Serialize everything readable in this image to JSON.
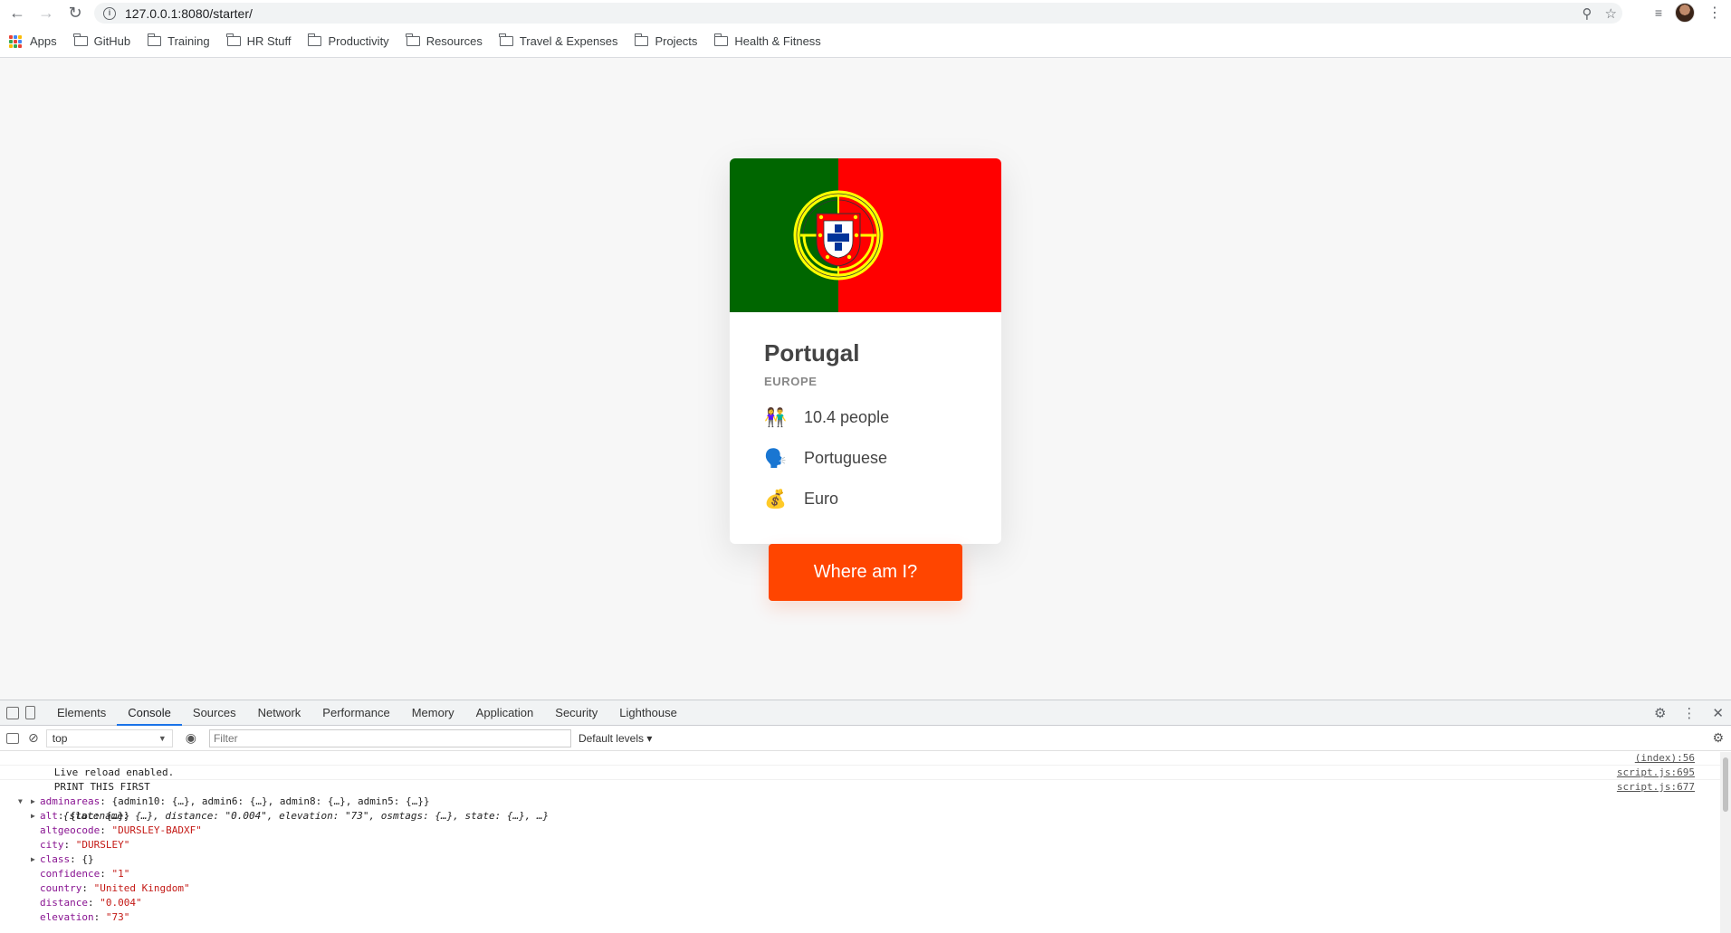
{
  "browser": {
    "url_host": "127.0.0.1:8080",
    "url_path": "/starter/",
    "bookmarks": [
      "Apps",
      "GitHub",
      "Training",
      "HR Stuff",
      "Productivity",
      "Resources",
      "Travel & Expenses",
      "Projects",
      "Health & Fitness"
    ]
  },
  "card": {
    "country": "Portugal",
    "region": "EUROPE",
    "population": "10.4 people",
    "language": "Portuguese",
    "currency": "Euro",
    "population_icon": "👫",
    "language_icon": "🗣️",
    "currency_icon": "💰",
    "flag_colors": {
      "green": "#006600",
      "red": "#ff0000",
      "gold": "#ffff00"
    }
  },
  "action_button": "Where am I?",
  "devtools": {
    "tabs": [
      "Elements",
      "Console",
      "Sources",
      "Network",
      "Performance",
      "Memory",
      "Application",
      "Security",
      "Lighthouse"
    ],
    "active_tab": "Console",
    "context": "top",
    "filter_placeholder": "Filter",
    "levels": "Default levels ▾",
    "messages": [
      {
        "text": "Live reload enabled.",
        "source": "(index):56"
      },
      {
        "text": "PRINT THIS FIRST",
        "source": "script.js:695"
      },
      {
        "text": "{statename: {…}, distance: \"0.004\", elevation: \"73\", osmtags: {…}, state: {…}, …}",
        "source": "script.js:677"
      }
    ],
    "props": [
      {
        "key": "adminareas",
        "value": "{admin10: {…}, admin6: {…}, admin8: {…}, admin5: {…}}",
        "type": "obj"
      },
      {
        "key": "alt",
        "value": "{loc: {…}}",
        "type": "obj"
      },
      {
        "key": "altgeocode",
        "value": "\"DURSLEY-BADXF\"",
        "type": "str"
      },
      {
        "key": "city",
        "value": "\"DURSLEY\"",
        "type": "str"
      },
      {
        "key": "class",
        "value": "{}",
        "type": "obj"
      },
      {
        "key": "confidence",
        "value": "\"1\"",
        "type": "str"
      },
      {
        "key": "country",
        "value": "\"United Kingdom\"",
        "type": "str"
      },
      {
        "key": "distance",
        "value": "\"0.004\"",
        "type": "str"
      },
      {
        "key": "elevation",
        "value": "\"73\"",
        "type": "str"
      }
    ]
  }
}
